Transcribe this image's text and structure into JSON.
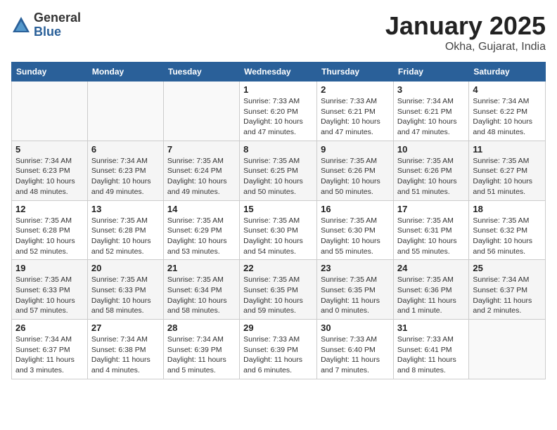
{
  "header": {
    "logo_general": "General",
    "logo_blue": "Blue",
    "title": "January 2025",
    "subtitle": "Okha, Gujarat, India"
  },
  "days_of_week": [
    "Sunday",
    "Monday",
    "Tuesday",
    "Wednesday",
    "Thursday",
    "Friday",
    "Saturday"
  ],
  "weeks": [
    [
      {
        "day": "",
        "info": ""
      },
      {
        "day": "",
        "info": ""
      },
      {
        "day": "",
        "info": ""
      },
      {
        "day": "1",
        "info": "Sunrise: 7:33 AM\nSunset: 6:20 PM\nDaylight: 10 hours\nand 47 minutes."
      },
      {
        "day": "2",
        "info": "Sunrise: 7:33 AM\nSunset: 6:21 PM\nDaylight: 10 hours\nand 47 minutes."
      },
      {
        "day": "3",
        "info": "Sunrise: 7:34 AM\nSunset: 6:21 PM\nDaylight: 10 hours\nand 47 minutes."
      },
      {
        "day": "4",
        "info": "Sunrise: 7:34 AM\nSunset: 6:22 PM\nDaylight: 10 hours\nand 48 minutes."
      }
    ],
    [
      {
        "day": "5",
        "info": "Sunrise: 7:34 AM\nSunset: 6:23 PM\nDaylight: 10 hours\nand 48 minutes."
      },
      {
        "day": "6",
        "info": "Sunrise: 7:34 AM\nSunset: 6:23 PM\nDaylight: 10 hours\nand 49 minutes."
      },
      {
        "day": "7",
        "info": "Sunrise: 7:35 AM\nSunset: 6:24 PM\nDaylight: 10 hours\nand 49 minutes."
      },
      {
        "day": "8",
        "info": "Sunrise: 7:35 AM\nSunset: 6:25 PM\nDaylight: 10 hours\nand 50 minutes."
      },
      {
        "day": "9",
        "info": "Sunrise: 7:35 AM\nSunset: 6:26 PM\nDaylight: 10 hours\nand 50 minutes."
      },
      {
        "day": "10",
        "info": "Sunrise: 7:35 AM\nSunset: 6:26 PM\nDaylight: 10 hours\nand 51 minutes."
      },
      {
        "day": "11",
        "info": "Sunrise: 7:35 AM\nSunset: 6:27 PM\nDaylight: 10 hours\nand 51 minutes."
      }
    ],
    [
      {
        "day": "12",
        "info": "Sunrise: 7:35 AM\nSunset: 6:28 PM\nDaylight: 10 hours\nand 52 minutes."
      },
      {
        "day": "13",
        "info": "Sunrise: 7:35 AM\nSunset: 6:28 PM\nDaylight: 10 hours\nand 52 minutes."
      },
      {
        "day": "14",
        "info": "Sunrise: 7:35 AM\nSunset: 6:29 PM\nDaylight: 10 hours\nand 53 minutes."
      },
      {
        "day": "15",
        "info": "Sunrise: 7:35 AM\nSunset: 6:30 PM\nDaylight: 10 hours\nand 54 minutes."
      },
      {
        "day": "16",
        "info": "Sunrise: 7:35 AM\nSunset: 6:30 PM\nDaylight: 10 hours\nand 55 minutes."
      },
      {
        "day": "17",
        "info": "Sunrise: 7:35 AM\nSunset: 6:31 PM\nDaylight: 10 hours\nand 55 minutes."
      },
      {
        "day": "18",
        "info": "Sunrise: 7:35 AM\nSunset: 6:32 PM\nDaylight: 10 hours\nand 56 minutes."
      }
    ],
    [
      {
        "day": "19",
        "info": "Sunrise: 7:35 AM\nSunset: 6:33 PM\nDaylight: 10 hours\nand 57 minutes."
      },
      {
        "day": "20",
        "info": "Sunrise: 7:35 AM\nSunset: 6:33 PM\nDaylight: 10 hours\nand 58 minutes."
      },
      {
        "day": "21",
        "info": "Sunrise: 7:35 AM\nSunset: 6:34 PM\nDaylight: 10 hours\nand 58 minutes."
      },
      {
        "day": "22",
        "info": "Sunrise: 7:35 AM\nSunset: 6:35 PM\nDaylight: 10 hours\nand 59 minutes."
      },
      {
        "day": "23",
        "info": "Sunrise: 7:35 AM\nSunset: 6:35 PM\nDaylight: 11 hours\nand 0 minutes."
      },
      {
        "day": "24",
        "info": "Sunrise: 7:35 AM\nSunset: 6:36 PM\nDaylight: 11 hours\nand 1 minute."
      },
      {
        "day": "25",
        "info": "Sunrise: 7:34 AM\nSunset: 6:37 PM\nDaylight: 11 hours\nand 2 minutes."
      }
    ],
    [
      {
        "day": "26",
        "info": "Sunrise: 7:34 AM\nSunset: 6:37 PM\nDaylight: 11 hours\nand 3 minutes."
      },
      {
        "day": "27",
        "info": "Sunrise: 7:34 AM\nSunset: 6:38 PM\nDaylight: 11 hours\nand 4 minutes."
      },
      {
        "day": "28",
        "info": "Sunrise: 7:34 AM\nSunset: 6:39 PM\nDaylight: 11 hours\nand 5 minutes."
      },
      {
        "day": "29",
        "info": "Sunrise: 7:33 AM\nSunset: 6:39 PM\nDaylight: 11 hours\nand 6 minutes."
      },
      {
        "day": "30",
        "info": "Sunrise: 7:33 AM\nSunset: 6:40 PM\nDaylight: 11 hours\nand 7 minutes."
      },
      {
        "day": "31",
        "info": "Sunrise: 7:33 AM\nSunset: 6:41 PM\nDaylight: 11 hours\nand 8 minutes."
      },
      {
        "day": "",
        "info": ""
      }
    ]
  ]
}
